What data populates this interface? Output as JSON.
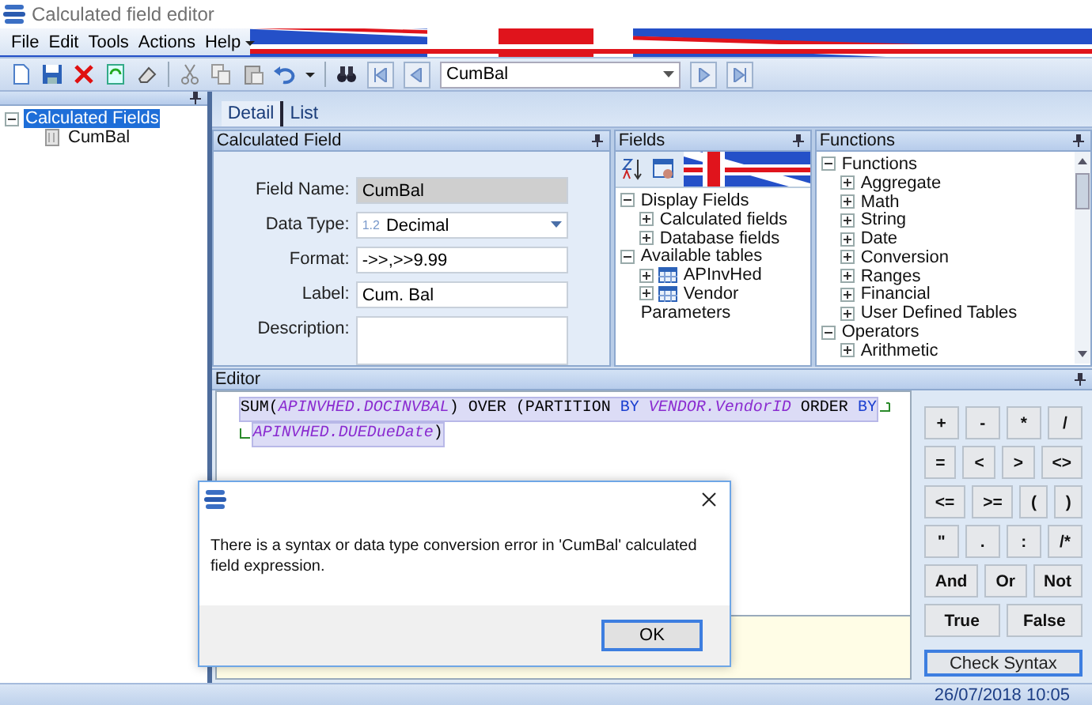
{
  "window": {
    "title": "Calculated field editor"
  },
  "menu": [
    "File",
    "Edit",
    "Tools",
    "Actions",
    "Help"
  ],
  "toolbar": {
    "record_combo": {
      "value": "CumBal"
    }
  },
  "navigator": {
    "items": [
      {
        "label": "Calculated Fields",
        "selected": true,
        "expanded": true,
        "children": [
          {
            "label": "CumBal",
            "selected": false,
            "kind": "field"
          }
        ]
      }
    ]
  },
  "tabs": [
    {
      "label": "Detail",
      "selected": true
    },
    {
      "label": "List",
      "selected": false
    }
  ],
  "calculated_field": {
    "title": "Calculated Field",
    "fields": [
      {
        "label": "Field Name:",
        "value": "CumBal",
        "kind": "readonly"
      },
      {
        "label": "Data Type:",
        "badge": "1.2",
        "value": "Decimal",
        "kind": "dropdown"
      },
      {
        "label": "Format:",
        "value": "->>,>>9.99",
        "kind": "text"
      },
      {
        "label": "Label:",
        "value": "Cum. Bal",
        "kind": "text"
      },
      {
        "label": "Description:",
        "kind": "multiline"
      }
    ]
  },
  "fields_panel": {
    "title": "Fields",
    "tree": [
      {
        "label": "Display Fields",
        "expanded": true,
        "children": [
          {
            "label": "Calculated fields",
            "expanded": false
          },
          {
            "label": "Database fields",
            "expanded": false
          }
        ]
      },
      {
        "label": "Available tables",
        "expanded": true,
        "children": [
          {
            "label": "APInvHed",
            "expanded": false,
            "kind": "table"
          },
          {
            "label": "Vendor",
            "expanded": false,
            "kind": "table"
          }
        ]
      },
      {
        "label": "Parameters"
      }
    ]
  },
  "functions_panel": {
    "title": "Functions",
    "tree": [
      {
        "label": "Functions",
        "expanded": true,
        "children": [
          {
            "label": "Aggregate",
            "expanded": false
          },
          {
            "label": "Math",
            "expanded": false
          },
          {
            "label": "String",
            "expanded": false
          },
          {
            "label": "Date",
            "expanded": false
          },
          {
            "label": "Conversion",
            "expanded": false
          },
          {
            "label": "Ranges",
            "expanded": false
          },
          {
            "label": "Financial",
            "expanded": false
          },
          {
            "label": "User Defined Tables",
            "expanded": false
          }
        ]
      },
      {
        "label": "Operators",
        "expanded": true,
        "children": [
          {
            "label": "Arithmetic",
            "expanded": false
          }
        ]
      }
    ]
  },
  "editor": {
    "title": "Editor",
    "lines": [
      {
        "wraps": true,
        "continued": false,
        "segments": [
          {
            "kind": "plain",
            "text": "SUM("
          },
          {
            "kind": "identifier",
            "text": "APINVHED.DOCINVBAL"
          },
          {
            "kind": "plain",
            "text": ") OVER (PARTITION"
          },
          {
            "kind": "keyword",
            "text": " BY "
          },
          {
            "kind": "identifier",
            "text": "VENDOR.VendorID"
          },
          {
            "kind": "plain",
            "text": " ORDER "
          },
          {
            "kind": "keyword",
            "text": "BY"
          }
        ]
      },
      {
        "wraps": false,
        "continued": true,
        "segments": [
          {
            "kind": "identifier",
            "text": "APINVHED.DUEDueDate"
          },
          {
            "kind": "plain",
            "text": ")"
          }
        ]
      }
    ]
  },
  "keypad": {
    "operators": [
      [
        "+",
        "-",
        "*",
        "/"
      ],
      [
        "=",
        "<",
        ">",
        "<>"
      ],
      [
        "<=",
        ">=",
        "(",
        ")"
      ],
      [
        "\"",
        ".",
        ":",
        "/*"
      ]
    ],
    "logic": [
      "And",
      "Or",
      "Not"
    ],
    "constants": [
      "True",
      "False"
    ],
    "check_syntax": "Check Syntax"
  },
  "status_bar": {
    "datetime": "26/07/2018 10:05"
  },
  "dialog": {
    "message": "There is a syntax or data type conversion error in 'CumBal' calculated field expression.",
    "ok": "OK"
  }
}
